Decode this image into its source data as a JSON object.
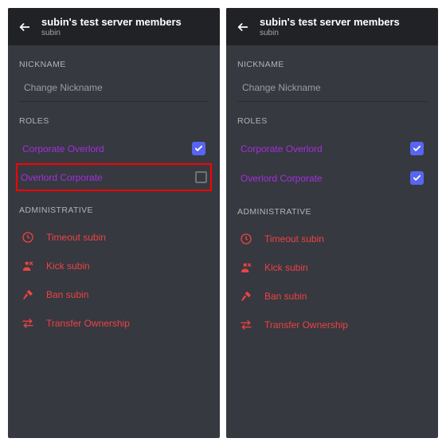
{
  "header": {
    "title": "subin's test server members",
    "subtitle": "subin"
  },
  "sections": {
    "nickname": "NICKNAME",
    "roles": "ROLES",
    "administrative": "ADMINISTRATIVE"
  },
  "nickname": {
    "placeholder": "Change Nickname"
  },
  "colors": {
    "role_purple": "#a52ee0",
    "danger": "#ed4245",
    "blurple": "#5865f2"
  },
  "left": {
    "roles": [
      {
        "label": "Corporate Overlord",
        "checked": true,
        "highlighted": false
      },
      {
        "label": "Overlord Corporate",
        "checked": false,
        "highlighted": true
      }
    ]
  },
  "right": {
    "roles": [
      {
        "label": "Corporate Overlord",
        "checked": true,
        "highlighted": false
      },
      {
        "label": "Overlord Corporate",
        "checked": true,
        "highlighted": false
      }
    ]
  },
  "admin": [
    {
      "icon": "clock-icon",
      "label": "Timeout subin"
    },
    {
      "icon": "kick-icon",
      "label": "Kick subin"
    },
    {
      "icon": "hammer-icon",
      "label": "Ban subin"
    },
    {
      "icon": "transfer-icon",
      "label": "Transfer Ownership"
    }
  ]
}
